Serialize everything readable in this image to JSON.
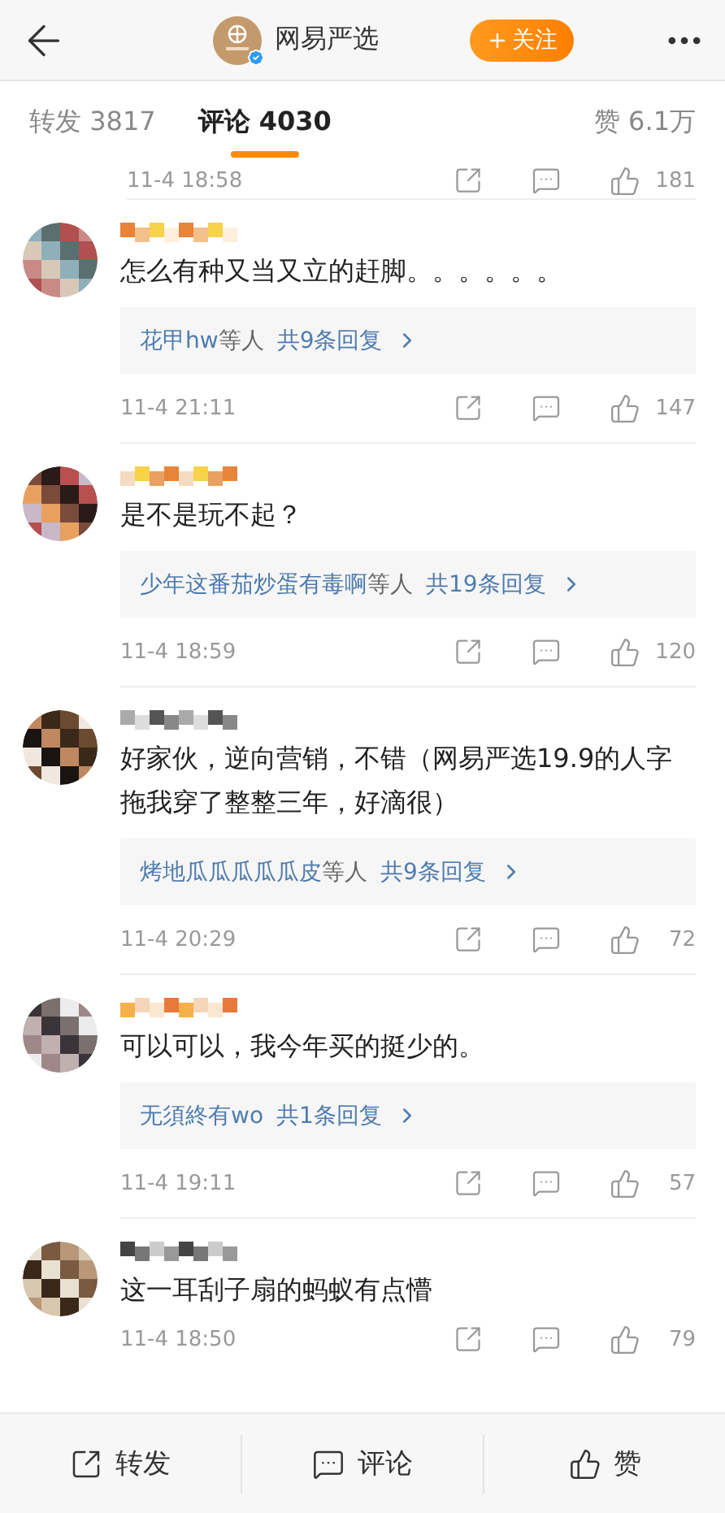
{
  "header": {
    "account": "网易严选",
    "verified": true,
    "follow": "关注"
  },
  "tabs": [
    {
      "label": "转发 3817",
      "selected": false
    },
    {
      "label": "评论 4030",
      "selected": true
    },
    {
      "label": "赞 6.1万",
      "selected": false
    }
  ],
  "partial_row": {
    "time": "11-4 18:58",
    "likes": "181"
  },
  "comments": [
    {
      "text": "怎么有种又当又立的赶脚。。。。。。",
      "reply": {
        "names": "花甲hw",
        "suffix": "等人",
        "count": "共9条回复"
      },
      "time": "11-4 21:11",
      "likes": "147"
    },
    {
      "text": "是不是玩不起？",
      "reply": {
        "names": "少年这番茄炒蛋有毒啊",
        "suffix": "等人",
        "count": "共19条回复"
      },
      "time": "11-4 18:59",
      "likes": "120"
    },
    {
      "text": "好家伙，逆向营销，不错（网易严选19.9的人字拖我穿了整整三年，好滴很）",
      "reply": {
        "names": "烤地瓜瓜瓜瓜瓜皮",
        "suffix": "等人",
        "count": "共9条回复"
      },
      "time": "11-4 20:29",
      "likes": "72"
    },
    {
      "text": "可以可以，我今年买的挺少的。",
      "reply": {
        "names": "无須終有wo",
        "count": "共1条回复"
      },
      "time": "11-4 19:11",
      "likes": "57"
    },
    {
      "text": "这一耳刮子扇的蚂蚁有点懵",
      "time": "11-4 18:50",
      "likes": "79"
    }
  ],
  "bottom_bar": [
    "转发",
    "评论",
    "赞"
  ]
}
